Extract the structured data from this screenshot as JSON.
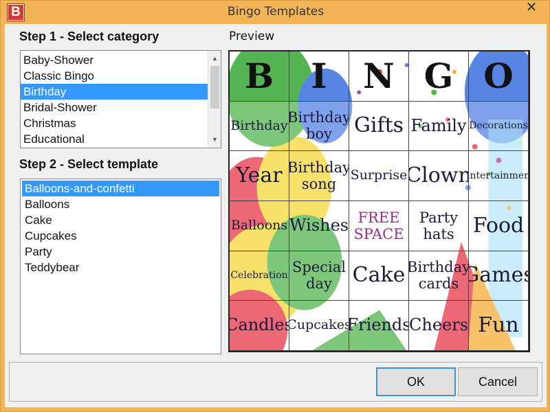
{
  "window": {
    "title": "Bingo Templates",
    "app_icon_letter": "B",
    "close_glyph": "✕"
  },
  "step1": {
    "label": "Step 1 - Select category",
    "items": [
      {
        "label": "Baby-Shower",
        "selected": false
      },
      {
        "label": "Classic Bingo",
        "selected": false
      },
      {
        "label": "Birthday",
        "selected": true
      },
      {
        "label": "Bridal-Shower",
        "selected": false
      },
      {
        "label": "Christmas",
        "selected": false
      },
      {
        "label": "Educational",
        "selected": false
      }
    ]
  },
  "step2": {
    "label": "Step 2 - Select template",
    "items": [
      {
        "label": "Balloons-and-confetti",
        "selected": true
      },
      {
        "label": "Balloons",
        "selected": false
      },
      {
        "label": "Cake",
        "selected": false
      },
      {
        "label": "Cupcakes",
        "selected": false
      },
      {
        "label": "Party",
        "selected": false
      },
      {
        "label": "Teddybear",
        "selected": false
      }
    ]
  },
  "preview": {
    "label": "Preview",
    "header": [
      "B",
      "I",
      "N",
      "G",
      "O"
    ],
    "rows": [
      [
        "Birthday",
        "Birthday boy",
        "Gifts",
        "Family",
        "Decorations"
      ],
      [
        "Year",
        "Birthday song",
        "Surprise",
        "Clown",
        "Entertainment"
      ],
      [
        "Balloons",
        "Wishes",
        "FREE SPACE",
        "Party hats",
        "Food"
      ],
      [
        "Celebration",
        "Special day",
        "Cake",
        "Birthday cards",
        "Games"
      ],
      [
        "Candles",
        "Cupcakes",
        "Friends",
        "Cheers",
        "Fun"
      ]
    ],
    "free_text": "FREE SPACE",
    "free_color": "#9b2a8a"
  },
  "buttons": {
    "ok": "OK",
    "cancel": "Cancel"
  },
  "colors": {
    "title_bar": "#f2b457",
    "selection": "#3399ff",
    "app_icon": "#d63a2f"
  }
}
